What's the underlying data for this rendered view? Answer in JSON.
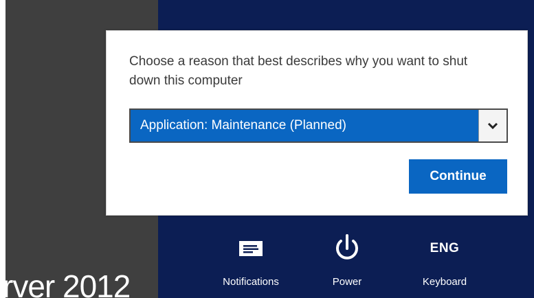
{
  "background": {
    "brand_text": "rver 2012",
    "left_color": "#3f3f3f",
    "charm_color": "#0c1e54"
  },
  "dialog": {
    "prompt": "Choose a reason that best describes why you want to shut down this computer",
    "selected_reason": "Application: Maintenance (Planned)",
    "continue_label": "Continue",
    "accent_color": "#0a66c2"
  },
  "charms": [
    {
      "label": "Notifications",
      "icon": "notifications-icon"
    },
    {
      "label": "Power",
      "icon": "power-icon"
    },
    {
      "label": "Keyboard",
      "icon_text": "ENG"
    }
  ]
}
